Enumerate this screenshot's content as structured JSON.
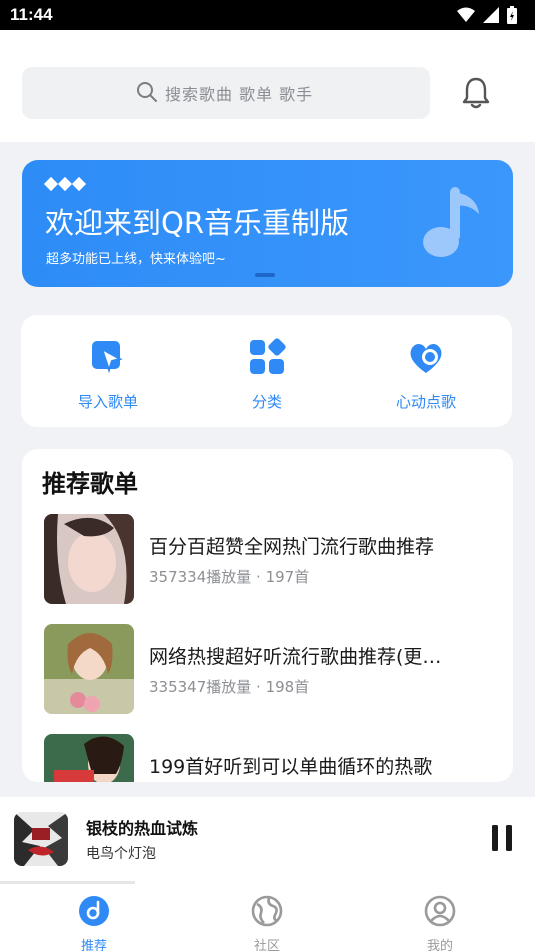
{
  "status_bar": {
    "time": "11:44"
  },
  "search": {
    "placeholder": "搜索歌曲 歌单 歌手"
  },
  "banner": {
    "title": "欢迎来到QR音乐重制版",
    "subtitle": "超多功能已上线，快来体验吧~"
  },
  "quick_actions": [
    {
      "label": "导入歌单",
      "icon": "import-icon"
    },
    {
      "label": "分类",
      "icon": "category-icon"
    },
    {
      "label": "心动点歌",
      "icon": "heart-icon"
    }
  ],
  "recommend": {
    "title": "推荐歌单",
    "playlists": [
      {
        "name": "百分百超赞全网热门流行歌曲推荐",
        "meta": "357334播放量 · 197首"
      },
      {
        "name": "网络热搜超好听流行歌曲推荐(更…",
        "meta": "335347播放量 · 198首"
      },
      {
        "name": "199首好听到可以单曲循环的热歌",
        "meta": ""
      }
    ]
  },
  "player": {
    "title": "银枝的热血试炼",
    "artist": "电鸟个灯泡"
  },
  "nav": [
    {
      "label": "推荐",
      "icon": "music-disc-icon",
      "active": true
    },
    {
      "label": "社区",
      "icon": "globe-icon",
      "active": false
    },
    {
      "label": "我的",
      "icon": "user-icon",
      "active": false
    }
  ],
  "colors": {
    "accent": "#2f8af5",
    "inactive": "#9a9a9a"
  }
}
